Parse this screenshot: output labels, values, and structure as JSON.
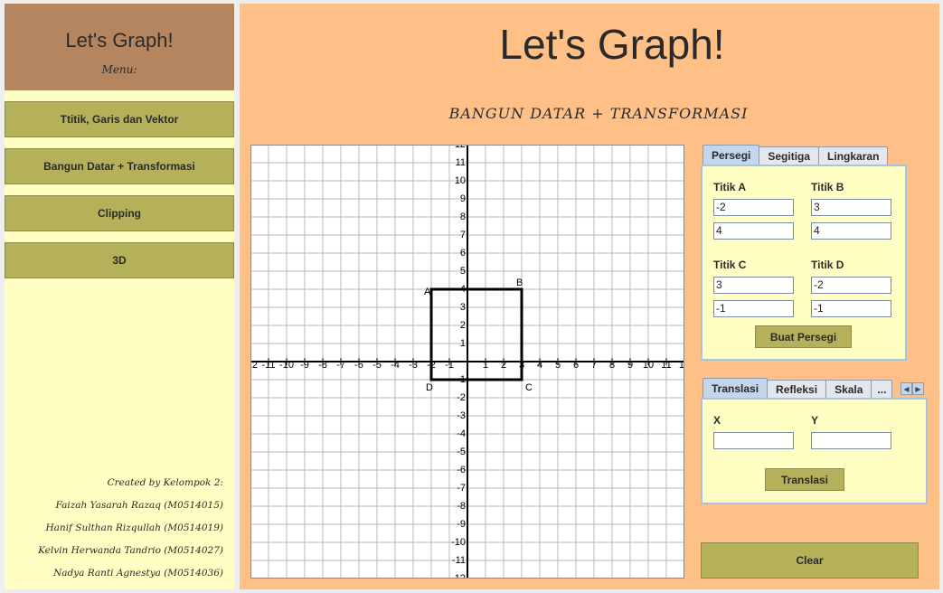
{
  "sidebar": {
    "title": "Let's Graph!",
    "menu_label": "Menu:",
    "items": [
      {
        "label": "Ttitik, Garis dan Vektor"
      },
      {
        "label": "Bangun Datar + Transformasi"
      },
      {
        "label": "Clipping"
      },
      {
        "label": "3D"
      }
    ],
    "credits": [
      "Created by Kelompok 2:",
      "Faizah Yasarah Razaq (M0514015)",
      "Hanif Sulthan Rizqullah (M0514019)",
      "Kelvin Herwanda Tandrio (M0514027)",
      "Nadya Ranti Agnestya (M0514036)"
    ]
  },
  "main": {
    "title": "Let's Graph!",
    "subtitle": "BANGUN DATAR + TRANSFORMASI"
  },
  "graph": {
    "xlim": [
      -12,
      12
    ],
    "ylim": [
      -12,
      12
    ],
    "grid": true,
    "square": {
      "points": [
        {
          "label": "A",
          "x": -2,
          "y": 4
        },
        {
          "label": "B",
          "x": 3,
          "y": 4
        },
        {
          "label": "C",
          "x": 3,
          "y": -1
        },
        {
          "label": "D",
          "x": -2,
          "y": -1
        }
      ]
    }
  },
  "shape_tabs": {
    "tabs": [
      "Persegi",
      "Segitiga",
      "Lingkaran"
    ],
    "active": "Persegi",
    "titik_a_label": "Titik A",
    "titik_b_label": "Titik B",
    "titik_c_label": "Titik C",
    "titik_d_label": "Titik D",
    "a_x": "-2",
    "a_y": "4",
    "b_x": "3",
    "b_y": "4",
    "c_x": "3",
    "c_y": "-1",
    "d_x": "-2",
    "d_y": "-1",
    "button_label": "Buat Persegi"
  },
  "transform_tabs": {
    "tabs": [
      "Translasi",
      "Refleksi",
      "Skala",
      "..."
    ],
    "active": "Translasi",
    "x_label": "X",
    "y_label": "Y",
    "x_value": "",
    "y_value": "",
    "button_label": "Translasi"
  },
  "clear_label": "Clear",
  "colors": {
    "sidebar_bg": "#ffffc3",
    "sidebar_header": "#b5855f",
    "button_olive": "#b5b15b",
    "main_bg": "#ffc088",
    "tab_active": "#c3d6eb"
  }
}
